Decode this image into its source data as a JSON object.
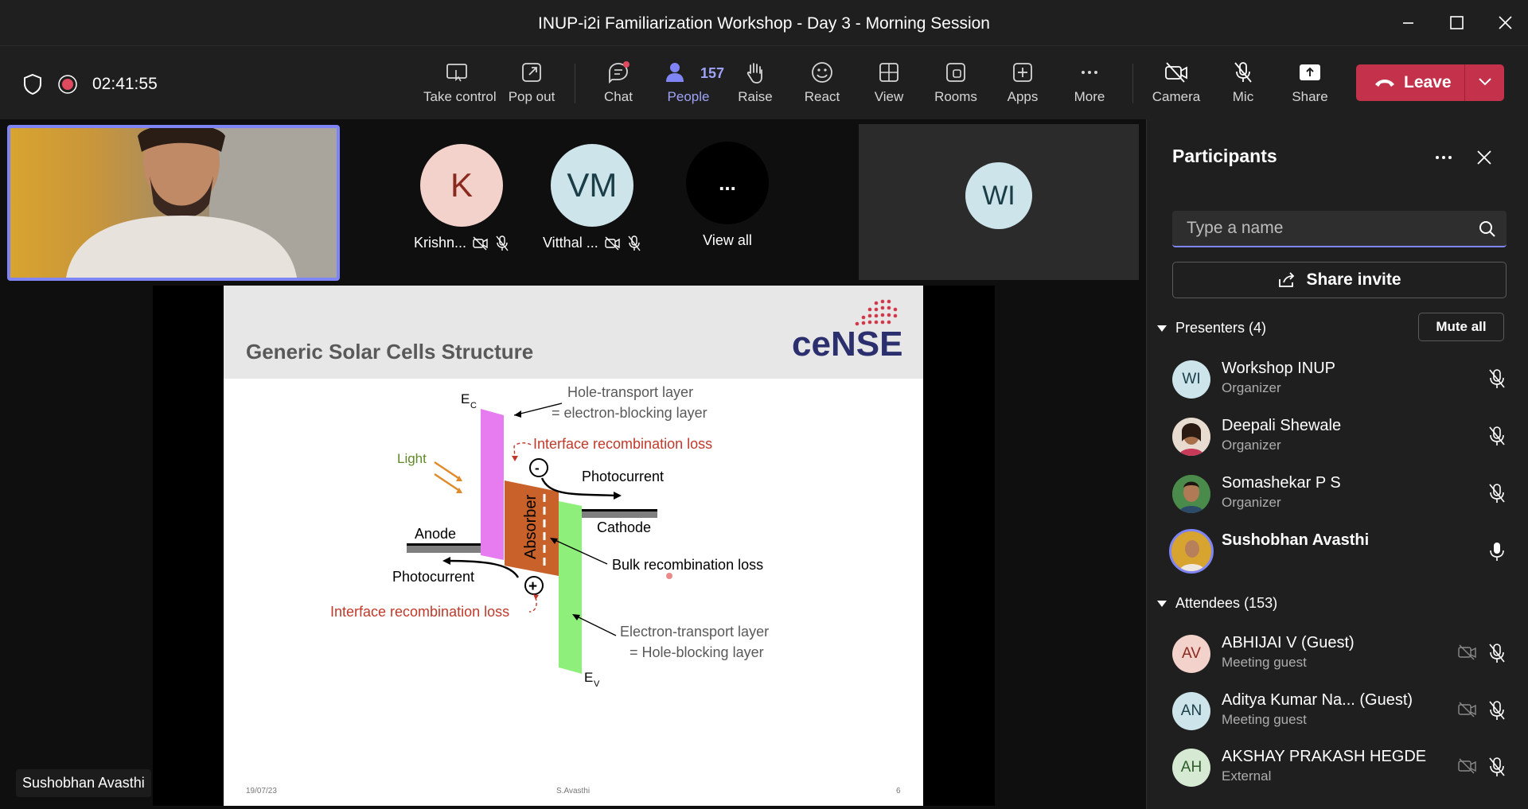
{
  "window": {
    "title": "INUP-i2i Familiarization Workshop - Day 3 - Morning Session"
  },
  "toolbar": {
    "timer": "02:41:55",
    "take_control": "Take control",
    "pop_out": "Pop out",
    "chat": "Chat",
    "people": "People",
    "people_count": "157",
    "raise": "Raise",
    "react": "React",
    "view": "View",
    "rooms": "Rooms",
    "apps": "Apps",
    "more": "More",
    "camera": "Camera",
    "mic": "Mic",
    "share": "Share",
    "leave": "Leave"
  },
  "stage": {
    "tiles": [
      {
        "initials": "K",
        "name": "Krishn...",
        "color": "#f3d2cb",
        "text_color": "#8a2a1f"
      },
      {
        "initials": "VM",
        "name": "Vitthal ...",
        "color": "#cde4ea",
        "text_color": "#1a3d47"
      },
      {
        "initials": "...",
        "name": "View all",
        "color": "#000000",
        "text_color": "#ffffff"
      }
    ],
    "wi_initials": "WI",
    "presenter_name": "Sushobhan Avasthi"
  },
  "slide": {
    "title": "Generic Solar Cells Structure",
    "logo_text": "ceNSE",
    "footer_date": "19/07/23",
    "footer_author": "S.Avasthi",
    "footer_page": "6",
    "labels": {
      "ec": "E",
      "ec_sub": "C",
      "ev": "E",
      "ev_sub": "V",
      "htl1": "Hole-transport layer",
      "htl2": "= electron-blocking layer",
      "irl_top": "Interface recombination loss",
      "light": "Light",
      "photocurrent_top": "Photocurrent",
      "anode": "Anode",
      "cathode": "Cathode",
      "absorber": "Absorber",
      "bulk": "Bulk  recombination loss",
      "photocurrent_bottom": "Photocurrent",
      "irl_bottom": "Interface recombination loss",
      "etl1": "Electron-transport layer",
      "etl2": "= Hole-blocking layer",
      "minus": "-",
      "plus": "+"
    }
  },
  "panel": {
    "title": "Participants",
    "search_placeholder": "Type a name",
    "share_invite": "Share invite",
    "presenters_header": "Presenters (4)",
    "mute_all": "Mute all",
    "attendees_header": "Attendees (153)",
    "presenters": [
      {
        "initials": "WI",
        "name": "Workshop INUP",
        "role": "Organizer",
        "color": "#cde4ea",
        "text_color": "#1a3d47"
      },
      {
        "initials": "",
        "name": "Deepali Shewale",
        "role": "Organizer",
        "color": "#6b4a3a",
        "text_color": "#ffffff"
      },
      {
        "initials": "",
        "name": "Somashekar P S",
        "role": "Organizer",
        "color": "#3a7a3a",
        "text_color": "#ffffff"
      },
      {
        "initials": "",
        "name": "Sushobhan Avasthi",
        "role": "",
        "color": "#c99a3a",
        "text_color": "#ffffff"
      }
    ],
    "attendees": [
      {
        "initials": "AV",
        "name": "ABHIJAI V (Guest)",
        "role": "Meeting guest",
        "color": "#f3d2cb",
        "text_color": "#8a2a1f"
      },
      {
        "initials": "AN",
        "name": "Aditya Kumar Na... (Guest)",
        "role": "Meeting guest",
        "color": "#cde4ea",
        "text_color": "#1a3d47"
      },
      {
        "initials": "AH",
        "name": "AKSHAY PRAKASH HEGDE",
        "role": "External",
        "color": "#d6ead3",
        "text_color": "#2e5a2a"
      }
    ]
  }
}
